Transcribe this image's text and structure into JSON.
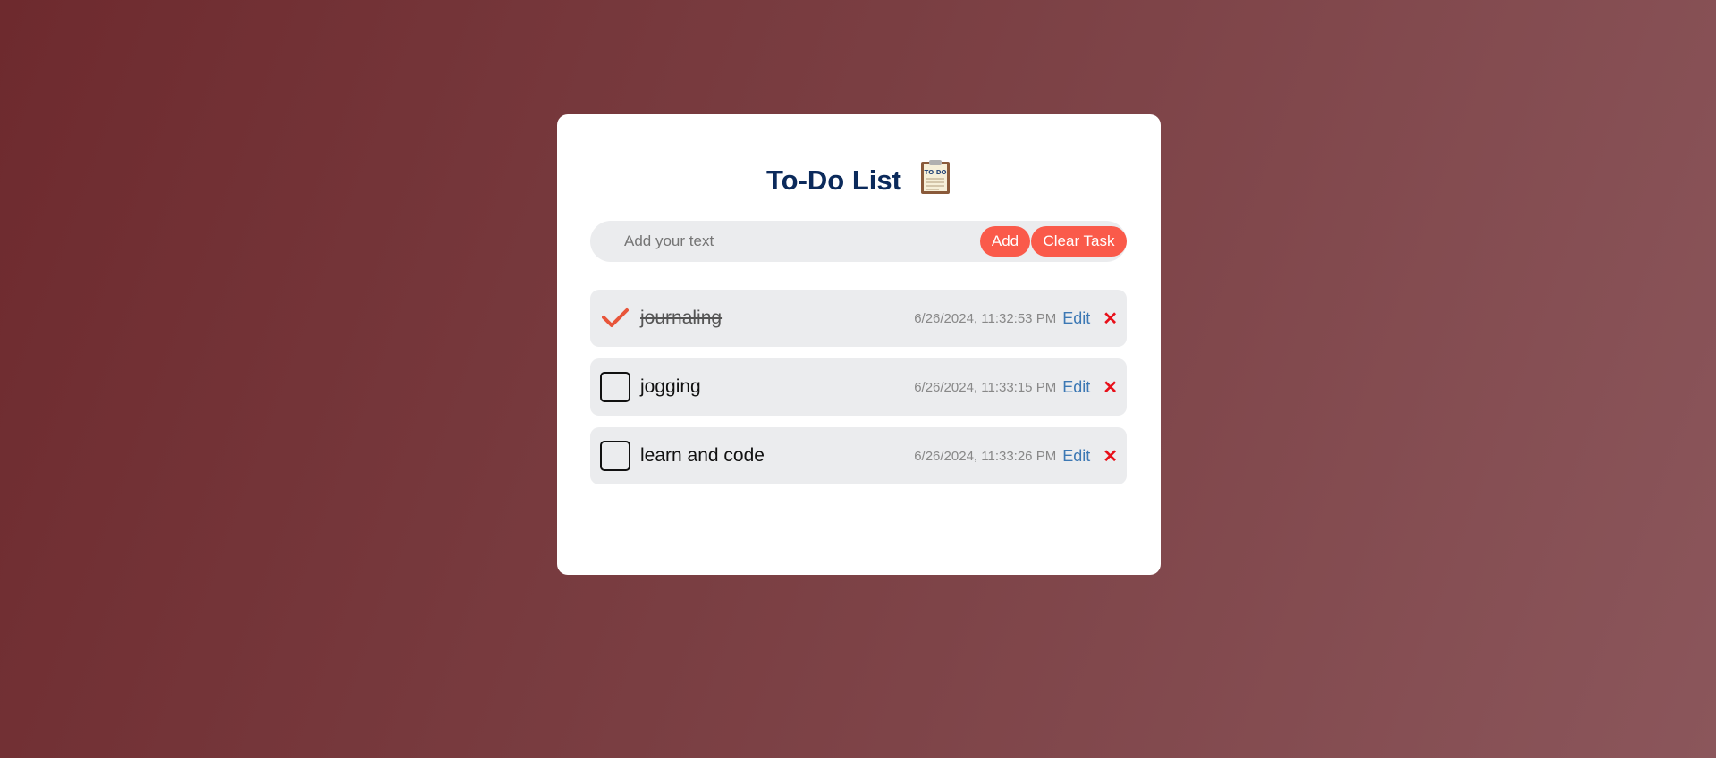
{
  "header": {
    "title": "To-Do List",
    "icon": "clipboard-todo-icon"
  },
  "input": {
    "placeholder": "Add your text",
    "value": ""
  },
  "buttons": {
    "add_label": "Add",
    "clear_label": "Clear Task"
  },
  "tasks": [
    {
      "text": "journaling",
      "completed": true,
      "timestamp": "6/26/2024, 11:32:53 PM",
      "edit_label": "Edit",
      "delete_label": "✕"
    },
    {
      "text": "jogging",
      "completed": false,
      "timestamp": "6/26/2024, 11:33:15 PM",
      "edit_label": "Edit",
      "delete_label": "✕"
    },
    {
      "text": "learn and code",
      "completed": false,
      "timestamp": "6/26/2024, 11:33:26 PM",
      "edit_label": "Edit",
      "delete_label": "✕"
    }
  ],
  "colors": {
    "accent": "#fa5a4a",
    "title": "#0b2a5b",
    "check": "#e8553a",
    "edit_link": "#3c78b4",
    "delete": "#e8101a"
  }
}
